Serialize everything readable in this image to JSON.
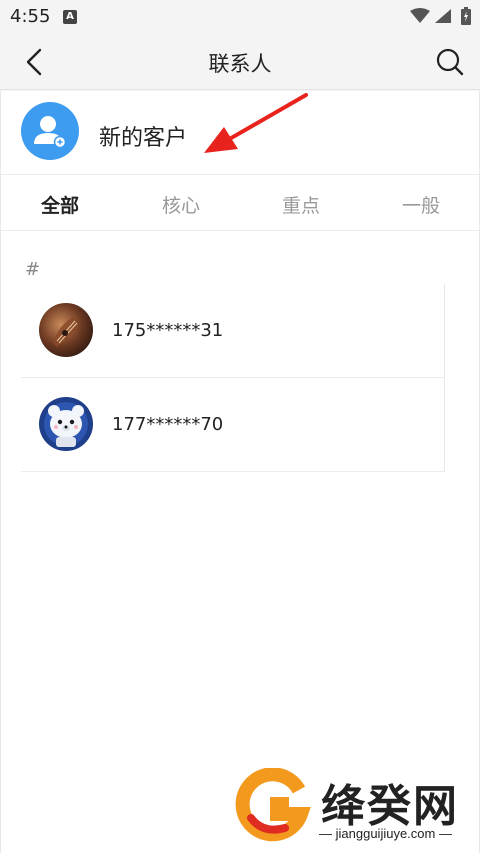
{
  "status_bar": {
    "time": "4:55",
    "notification_badge": "A"
  },
  "header": {
    "title": "联系人",
    "back_icon": "chevron-left-icon",
    "search_icon": "search-icon"
  },
  "new_customer": {
    "label": "新的客户",
    "icon": "add-user-icon",
    "accent_color": "#3d9cf0"
  },
  "annotation": {
    "arrow_color": "#e8231d"
  },
  "tabs": [
    {
      "label": "全部",
      "active": true
    },
    {
      "label": "核心",
      "active": false
    },
    {
      "label": "重点",
      "active": false
    },
    {
      "label": "一般",
      "active": false
    }
  ],
  "contacts": {
    "section_letter": "#",
    "items": [
      {
        "name": "175******31",
        "avatar": "violin-photo-avatar"
      },
      {
        "name": "177******70",
        "avatar": "polar-bear-cartoon-avatar"
      }
    ]
  },
  "watermark": {
    "brand": "绛癸网",
    "url": "jiangguijiuye.com"
  }
}
